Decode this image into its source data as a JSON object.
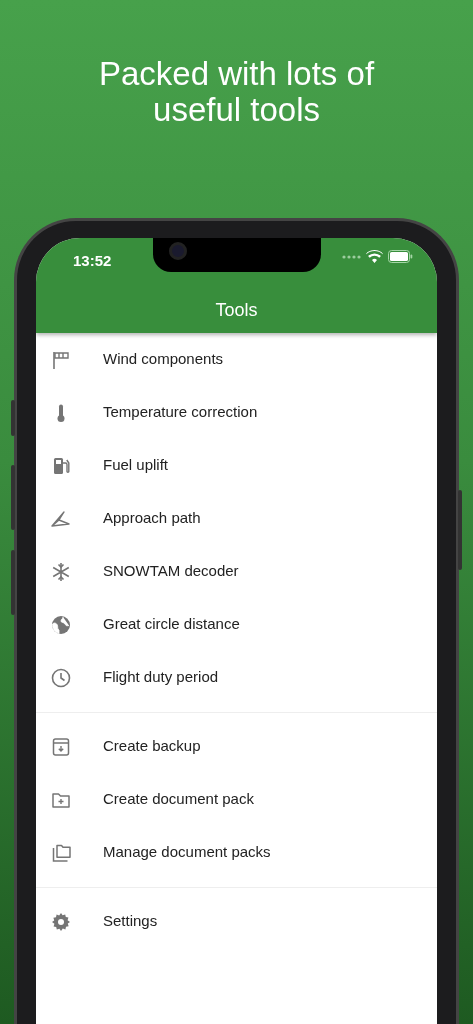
{
  "headline": "Packed with lots of useful tools",
  "status_bar": {
    "time": "13:52"
  },
  "app_bar": {
    "title": "Tools"
  },
  "sections": [
    {
      "items": [
        {
          "kind": "windsock",
          "label": "Wind components"
        },
        {
          "kind": "thermometer",
          "label": "Temperature correction"
        },
        {
          "kind": "fuel",
          "label": "Fuel uplift"
        },
        {
          "kind": "approach",
          "label": "Approach path"
        },
        {
          "kind": "snowflake",
          "label": "SNOWTAM decoder"
        },
        {
          "kind": "globe",
          "label": "Great circle distance"
        },
        {
          "kind": "clock",
          "label": "Flight duty period"
        }
      ]
    },
    {
      "items": [
        {
          "kind": "archive",
          "label": "Create backup"
        },
        {
          "kind": "folderplus",
          "label": "Create document pack"
        },
        {
          "kind": "folders",
          "label": "Manage document packs"
        }
      ]
    },
    {
      "items": [
        {
          "kind": "gear",
          "label": "Settings"
        }
      ]
    }
  ]
}
